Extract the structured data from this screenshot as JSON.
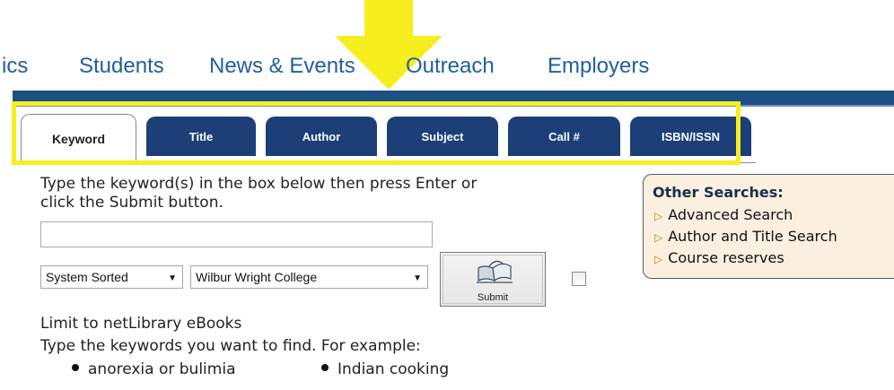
{
  "topnav": {
    "items": [
      "ics",
      "Students",
      "News & Events",
      "Outreach",
      "Employers"
    ]
  },
  "tabs": [
    {
      "label": "Keyword",
      "active": true
    },
    {
      "label": "Title",
      "active": false
    },
    {
      "label": "Author",
      "active": false
    },
    {
      "label": "Subject",
      "active": false
    },
    {
      "label": "Call #",
      "active": false
    },
    {
      "label": "ISBN/ISSN",
      "active": false
    }
  ],
  "search": {
    "instruction_line1": "Type the keyword(s) in the box below then press Enter or",
    "instruction_line2": "click the Submit button.",
    "input_value": "",
    "sort_select": "System Sorted",
    "location_select": "Wilbur Wright College",
    "submit_label": "Submit",
    "checkbox_checked": false,
    "limit_label": "Limit to netLibrary eBooks",
    "example_intro": "Type the keywords you want to find. For example:",
    "examples": [
      "anorexia or bulimia",
      "Indian cooking"
    ]
  },
  "other_searches": {
    "title": "Other Searches:",
    "items": [
      "Advanced Search",
      "Author and Title Search",
      "Course reserves"
    ]
  },
  "colors": {
    "nav_text": "#1f5fa0",
    "tab_bg": "#1c3f78",
    "highlight": "#f7ee1e",
    "arrow": "#f7ee1e",
    "panel_bg": "#fbf0e0"
  }
}
